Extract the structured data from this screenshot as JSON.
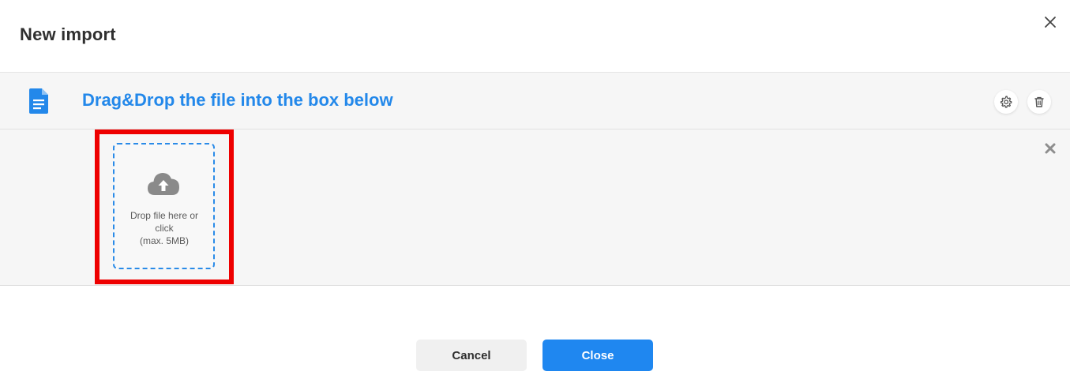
{
  "dialog": {
    "title": "New import"
  },
  "file_bar": {
    "title": "Drag&Drop the file into the box below",
    "icons": {
      "file": "document-icon",
      "settings": "gear-icon",
      "delete": "trash-icon"
    }
  },
  "dropzone": {
    "line1": "Drop file here or",
    "line2": "click",
    "line3": "(max. 5MB)",
    "icon": "cloud-upload-icon"
  },
  "footer": {
    "cancel_label": "Cancel",
    "close_label": "Close"
  },
  "colors": {
    "accent": "#2388ea",
    "primary_button": "#1f87f0",
    "highlight": "#ee0000",
    "panel_bg": "#f6f6f6"
  }
}
